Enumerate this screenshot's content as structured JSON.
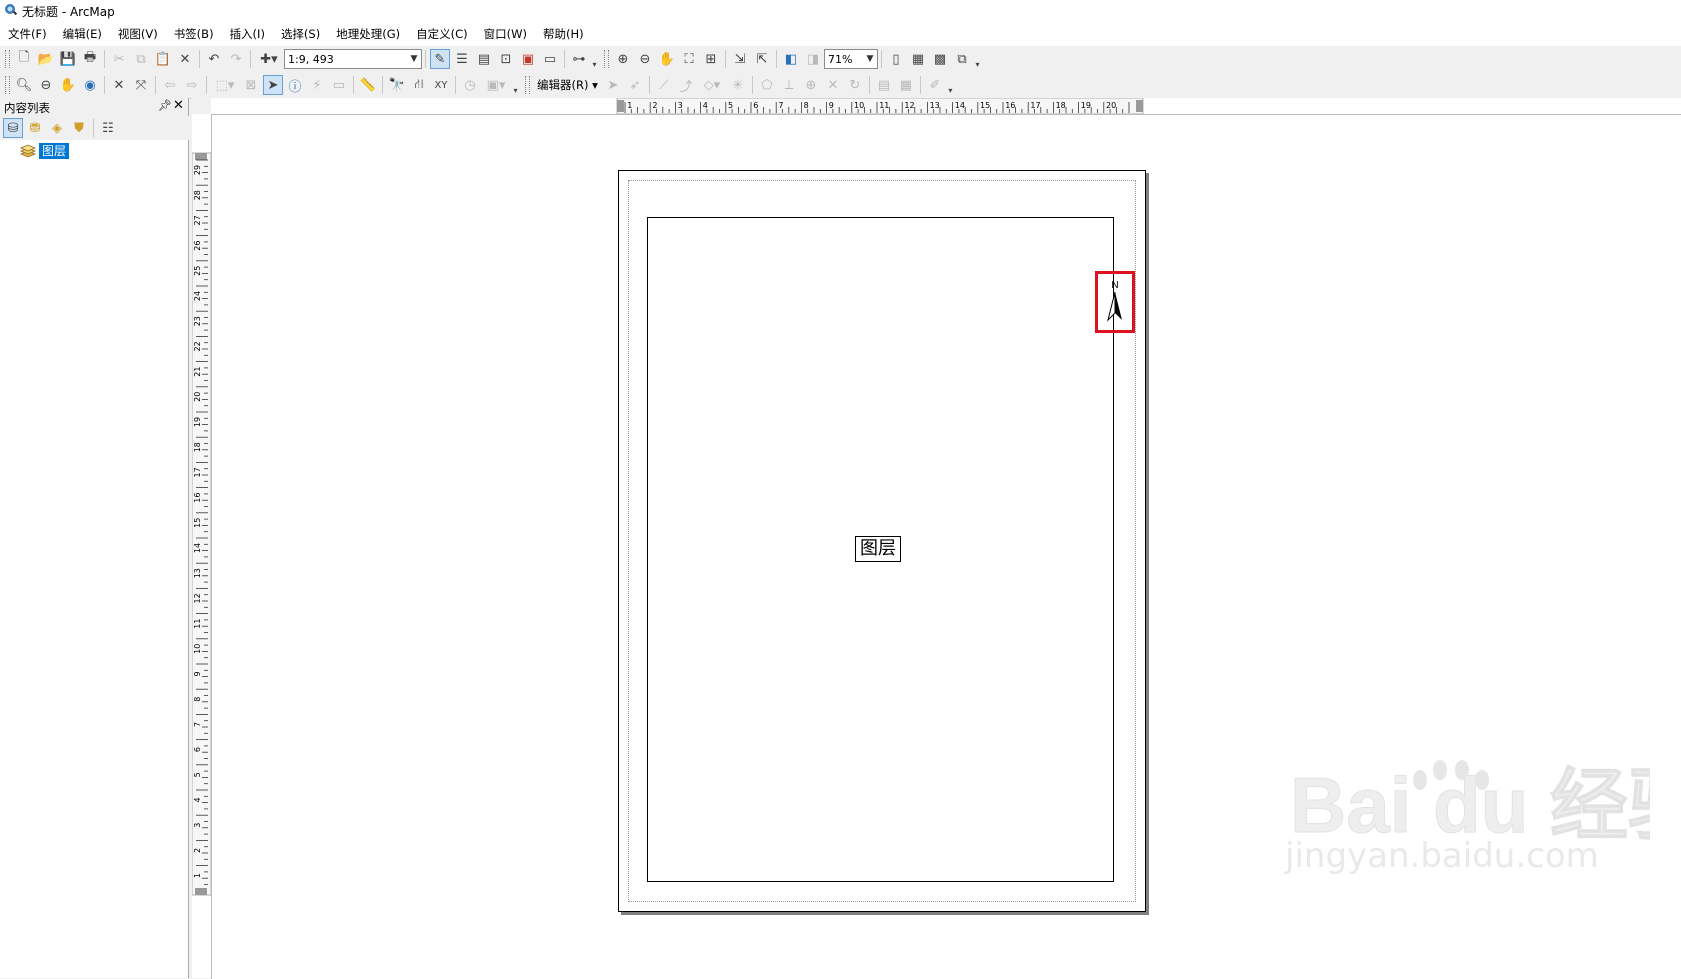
{
  "window": {
    "title": "无标题 - ArcMap"
  },
  "menu": {
    "items": [
      "文件(F)",
      "编辑(E)",
      "视图(V)",
      "书签(B)",
      "插入(I)",
      "选择(S)",
      "地理处理(G)",
      "自定义(C)",
      "窗口(W)",
      "帮助(H)"
    ]
  },
  "toolbar": {
    "scale_value": "1:9, 493",
    "zoom_value": "71%",
    "editor_label": "编辑器(R) ▾"
  },
  "toc": {
    "title": "内容列表",
    "layer_label": "图层"
  },
  "layout": {
    "data_frame_label": "图层",
    "north_label": "N",
    "hruler_ticks": [
      "1",
      "2",
      "3",
      "4",
      "5",
      "6",
      "7",
      "8",
      "9",
      "10",
      "11",
      "12",
      "13",
      "14",
      "15",
      "16",
      "17",
      "18",
      "19",
      "20"
    ],
    "vruler_ticks": [
      "29",
      "28",
      "27",
      "26",
      "25",
      "24",
      "23",
      "22",
      "21",
      "20",
      "19",
      "18",
      "17",
      "16",
      "15",
      "14",
      "13",
      "12",
      "11",
      "10",
      "9",
      "8",
      "7",
      "6",
      "5",
      "4",
      "3",
      "2",
      "1"
    ]
  },
  "watermark": {
    "logo_text": "Bai du 经验",
    "url_text": "jingyan.baidu.com"
  },
  "colors": {
    "highlight_box": "#e01020",
    "selection": "#0078d7"
  }
}
